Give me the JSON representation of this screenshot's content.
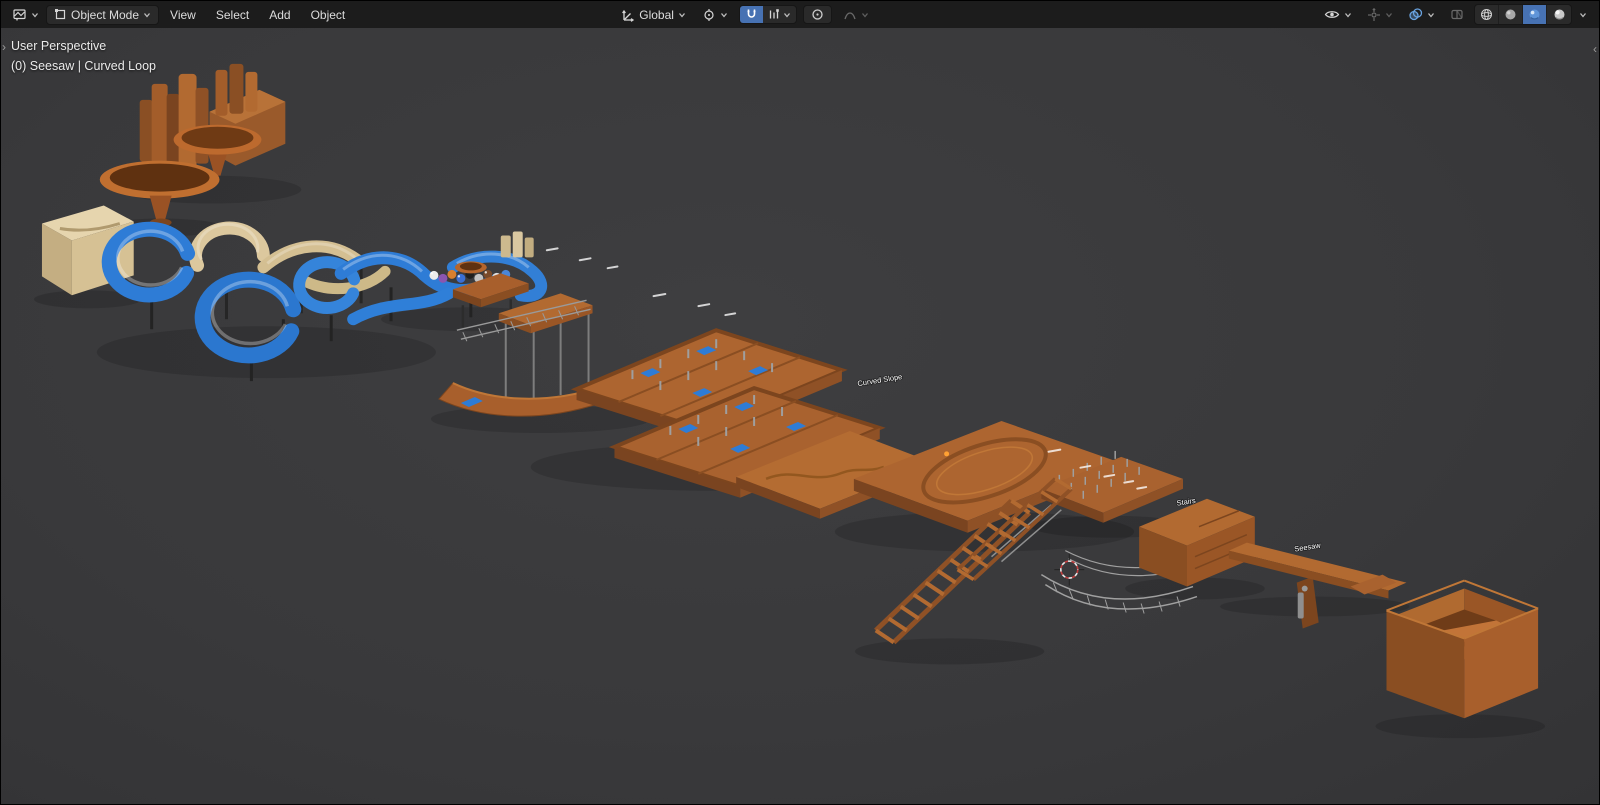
{
  "header": {
    "mode": "Object Mode",
    "menus": [
      "View",
      "Select",
      "Add",
      "Object"
    ],
    "orientation": "Global"
  },
  "viewport": {
    "perspective_label": "User Perspective",
    "active_object_label": "(0) Seesaw | Curved Loop",
    "object_labels": [
      "Curved Slope",
      "Stairs",
      "Seesaw"
    ],
    "edge_arrows": {
      "left": "›",
      "right": "‹"
    }
  },
  "icons": [
    "editor-type-icon",
    "chevron-down-icon",
    "object-mode-icon",
    "transform-orientation-icon",
    "pivot-point-icon",
    "magnet-icon",
    "snap-settings-icon",
    "proportional-editing-icon",
    "falloff-curve-icon",
    "visibility-eye-icon",
    "gizmo-icon",
    "overlays-icon",
    "xray-icon",
    "wireframe-shading-icon",
    "solid-shading-icon",
    "material-shading-icon",
    "rendered-shading-icon"
  ],
  "colors": {
    "header_bg": "#1c1c1c",
    "viewport_bg": "#3a3a3b",
    "accent_blue": "#4772b3",
    "text": "#dcdcdc",
    "wood": "#a9622f",
    "wood_dark": "#7c451e",
    "tan": "#d9c7a0",
    "tube_blue": "#2e7cd6",
    "cursor_red": "#c23f3f",
    "origin_orange": "#ffa133"
  }
}
